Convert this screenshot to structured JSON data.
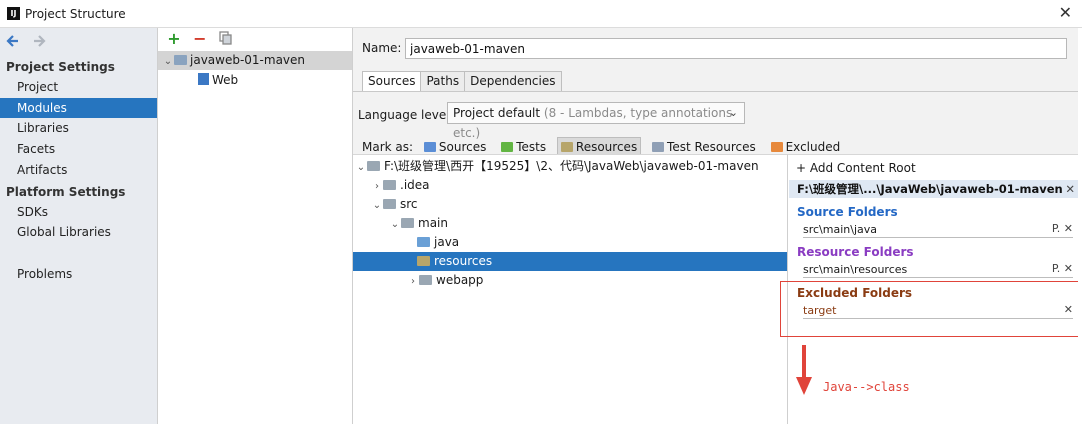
{
  "window": {
    "title": "Project Structure",
    "icon_label": "IJ"
  },
  "nav": {
    "project_settings_heading": "Project Settings",
    "project_items": [
      "Project",
      "Modules",
      "Libraries",
      "Facets",
      "Artifacts"
    ],
    "selected": "Modules",
    "platform_settings_heading": "Platform Settings",
    "platform_items": [
      "SDKs",
      "Global Libraries"
    ],
    "other_items": [
      "Problems"
    ]
  },
  "modules": {
    "toolbar": {
      "add": "+",
      "remove": "−"
    },
    "tree": [
      {
        "label": "javaweb-01-maven",
        "selected": true
      },
      {
        "label": "Web"
      }
    ]
  },
  "editor": {
    "name_label": "Name:",
    "name_value": "javaweb-01-maven",
    "tabs": [
      "Sources",
      "Paths",
      "Dependencies"
    ],
    "active_tab": "Sources",
    "language_level_label": "Language level:",
    "language_level_value": "Project default",
    "language_level_hint": "(8 - Lambdas, type annotations etc.)",
    "mark_as_label": "Mark as:",
    "mark_as": [
      {
        "label": "Sources",
        "color": "#5b8ed6"
      },
      {
        "label": "Tests",
        "color": "#62b543"
      },
      {
        "label": "Resources",
        "color": "#b7a56a",
        "pressed": true
      },
      {
        "label": "Test Resources",
        "color": "#8f9fb5"
      },
      {
        "label": "Excluded",
        "color": "#e7893c"
      }
    ],
    "file_tree": [
      {
        "label": "F:\\班级管理\\西开【19525】\\2、代码\\JavaWeb\\javaweb-01-maven",
        "chevron": "⌄"
      },
      {
        "label": ".idea",
        "chevron": "›"
      },
      {
        "label": "src",
        "chevron": "⌄"
      },
      {
        "label": "main",
        "chevron": "⌄"
      },
      {
        "label": "java",
        "chevron": ""
      },
      {
        "label": "resources",
        "chevron": "",
        "selected": true
      },
      {
        "label": "webapp",
        "chevron": "›"
      }
    ]
  },
  "content_root": {
    "add_label": "+ Add Content Root",
    "root_path": "F:\\班级管理\\...\\JavaWeb\\javaweb-01-maven",
    "source_title": "Source Folders",
    "source_item": "src\\main\\java",
    "resource_title": "Resource Folders",
    "resource_item": "src\\main\\resources",
    "excluded_title": "Excluded Folders",
    "excluded_item": "target",
    "colors": {
      "source": "#2468c5",
      "resource": "#8a3cc2",
      "excluded": "#8a3b12"
    }
  },
  "annotation": {
    "text": "Java-->class",
    "color": "#e0443a"
  }
}
